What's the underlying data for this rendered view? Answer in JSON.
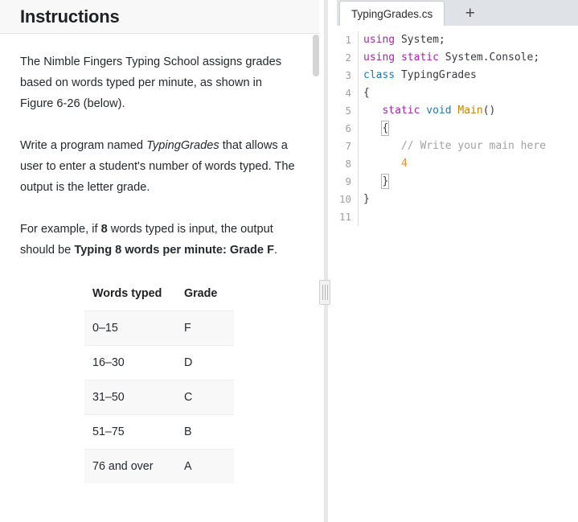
{
  "instructions": {
    "title": "Instructions",
    "paragraphs": [
      {
        "id": "p1",
        "runs": [
          {
            "text": "The Nimble Fingers Typing School assigns grades based on words typed per minute, as shown in Figure 6-26 (below).",
            "style": "normal"
          }
        ]
      },
      {
        "id": "p2",
        "runs": [
          {
            "text": "Write a program named ",
            "style": "normal"
          },
          {
            "text": "TypingGrades",
            "style": "italic"
          },
          {
            "text": " that allows a user to enter a student's number of words typed. The output is the letter grade.",
            "style": "normal"
          }
        ]
      },
      {
        "id": "p3",
        "runs": [
          {
            "text": "For example, if ",
            "style": "normal"
          },
          {
            "text": "8",
            "style": "bold"
          },
          {
            "text": " words typed is input, the output should be ",
            "style": "normal"
          },
          {
            "text": "Typing 8 words per minute: Grade F",
            "style": "bold"
          },
          {
            "text": ".",
            "style": "normal"
          }
        ]
      }
    ],
    "table": {
      "headers": [
        "Words typed",
        "Grade"
      ],
      "rows": [
        [
          "0–15",
          "F"
        ],
        [
          "16–30",
          "D"
        ],
        [
          "31–50",
          "C"
        ],
        [
          "51–75",
          "B"
        ],
        [
          "76 and over",
          "A"
        ]
      ]
    }
  },
  "splitter": {
    "handle_name": "pane-resize-handle"
  },
  "editor": {
    "tabs": [
      {
        "label": "TypingGrades.cs",
        "active": true
      }
    ],
    "add_tab_label": "+",
    "line_numbers": [
      "1",
      "2",
      "3",
      "4",
      "5",
      "6",
      "7",
      "8",
      "9",
      "10",
      "11"
    ],
    "code_lines": [
      {
        "n": "1",
        "tokens": [
          {
            "t": "using",
            "c": "keyword"
          },
          {
            "t": " System;",
            "c": "plain"
          }
        ]
      },
      {
        "n": "2",
        "tokens": [
          {
            "t": "using",
            "c": "keyword"
          },
          {
            "t": " ",
            "c": "plain"
          },
          {
            "t": "static",
            "c": "keyword"
          },
          {
            "t": " System.Console;",
            "c": "plain"
          }
        ]
      },
      {
        "n": "3",
        "tokens": [
          {
            "t": "class",
            "c": "class"
          },
          {
            "t": " TypingGrades",
            "c": "plain"
          }
        ]
      },
      {
        "n": "4",
        "tokens": [
          {
            "t": "{",
            "c": "plain"
          }
        ]
      },
      {
        "n": "5",
        "tokens": [
          {
            "t": "   ",
            "c": "plain"
          },
          {
            "t": "static",
            "c": "keyword"
          },
          {
            "t": " ",
            "c": "plain"
          },
          {
            "t": "void",
            "c": "type"
          },
          {
            "t": " ",
            "c": "plain"
          },
          {
            "t": "Main",
            "c": "func"
          },
          {
            "t": "()",
            "c": "plain"
          }
        ]
      },
      {
        "n": "6",
        "tokens": [
          {
            "t": "   ",
            "c": "plain"
          },
          {
            "t": "{",
            "c": "plain",
            "match": true
          }
        ]
      },
      {
        "n": "7",
        "tokens": [
          {
            "t": "      ",
            "c": "plain"
          },
          {
            "t": "// Write your main here",
            "c": "comment"
          }
        ]
      },
      {
        "n": "8",
        "tokens": [
          {
            "t": "      ",
            "c": "plain"
          },
          {
            "t": "4",
            "c": "number"
          }
        ]
      },
      {
        "n": "9",
        "tokens": [
          {
            "t": "   ",
            "c": "plain"
          },
          {
            "t": "}",
            "c": "plain",
            "match": true
          }
        ]
      },
      {
        "n": "10",
        "tokens": [
          {
            "t": "}",
            "c": "plain"
          }
        ]
      },
      {
        "n": "11",
        "tokens": []
      }
    ]
  },
  "colors": {
    "keyword": "#a626a4",
    "class": "#1a78c2",
    "function": "#c18401",
    "comment": "#a0a1a7",
    "number": "#e8912d",
    "text": "#383a42",
    "tab_bar_bg": "#dfe2e7",
    "header_bg": "#f8f8f8"
  }
}
